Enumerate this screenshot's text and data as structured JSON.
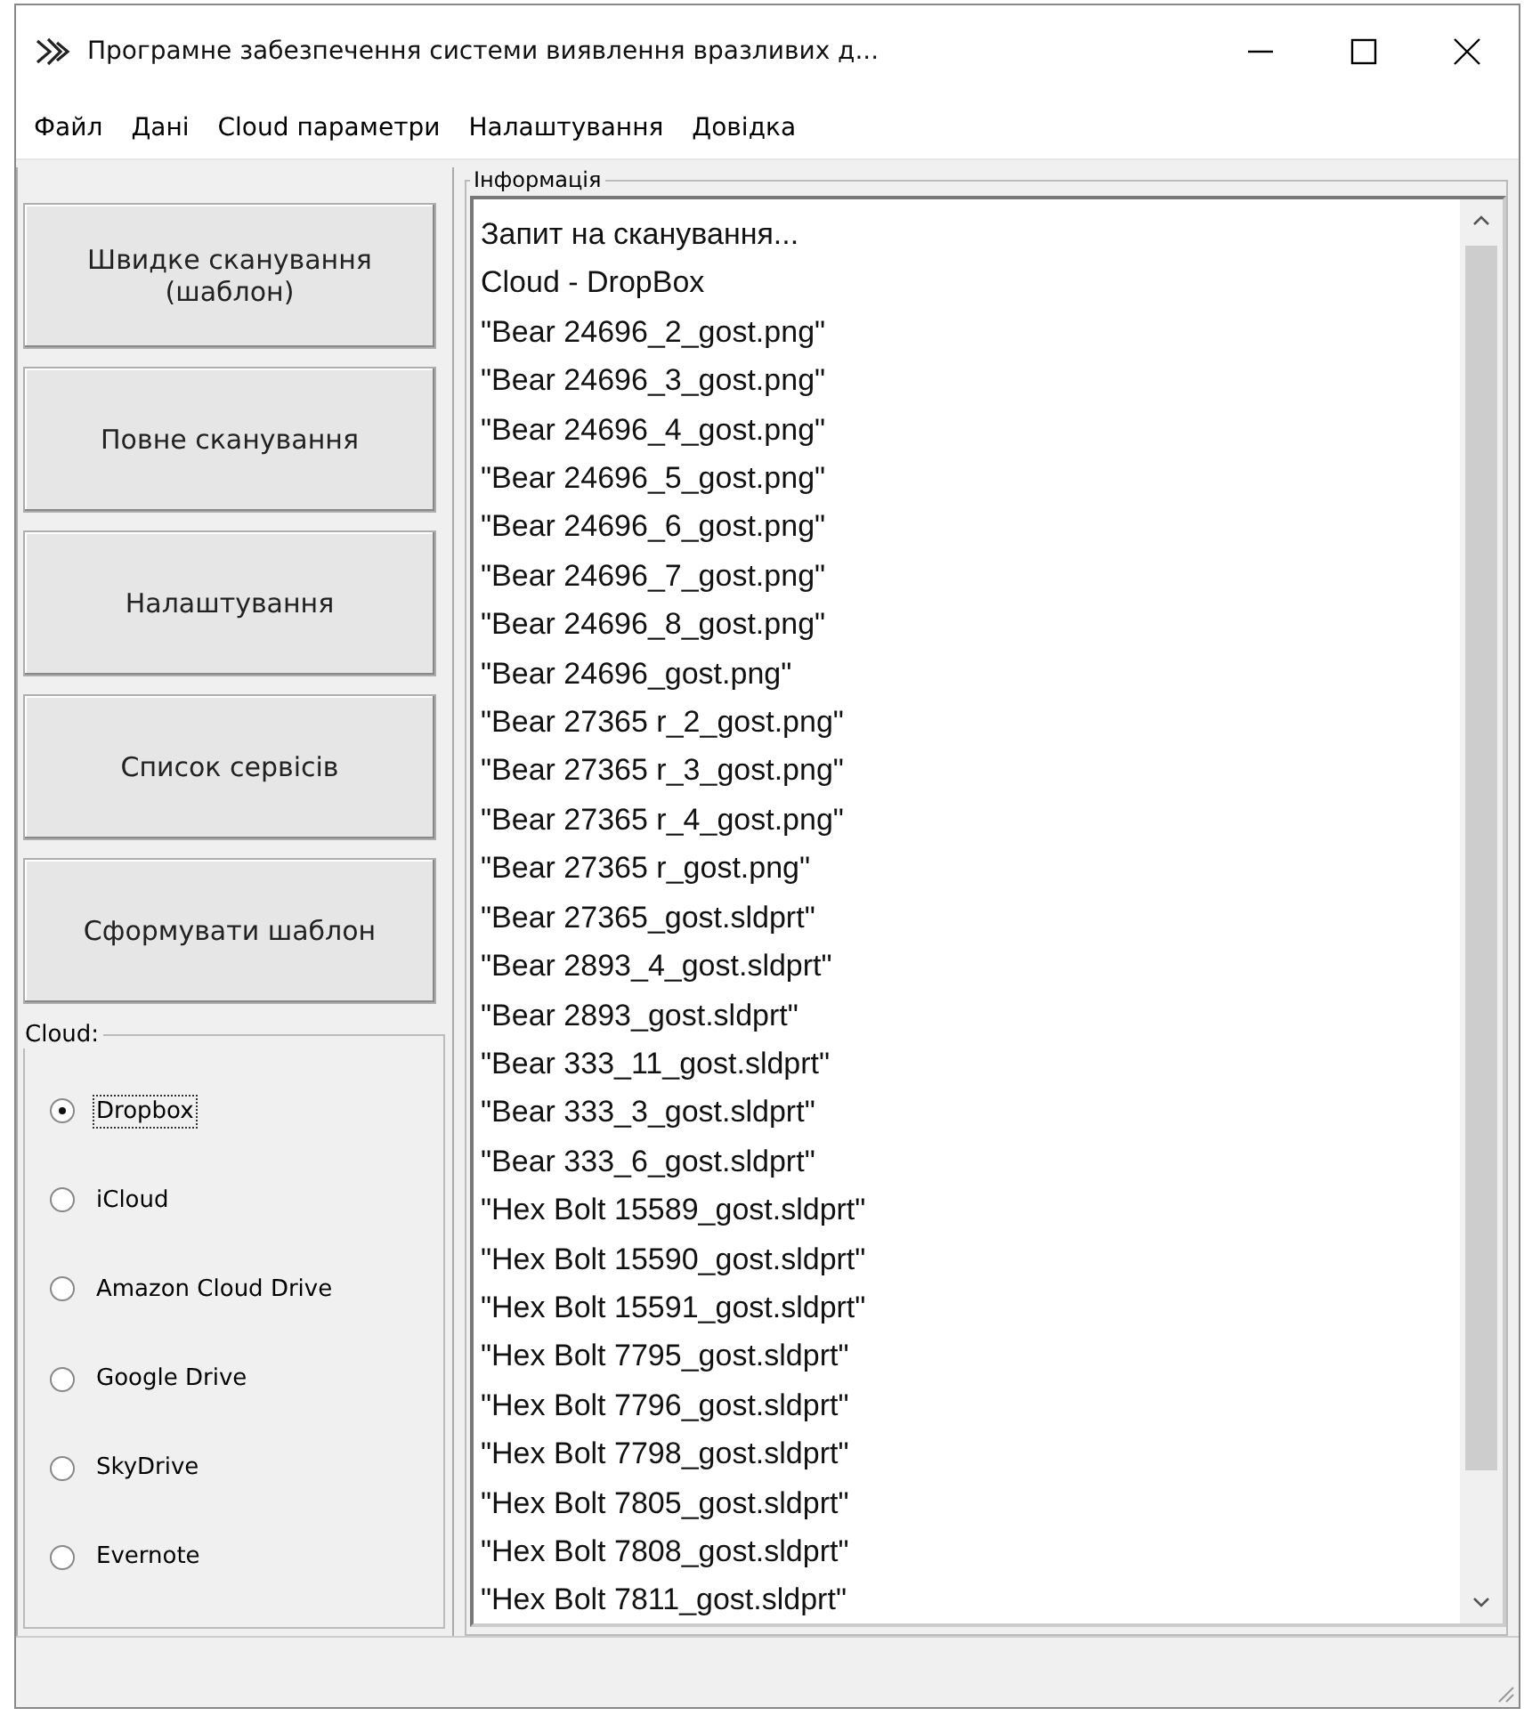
{
  "window": {
    "title": "Програмне забезпечення системи виявлення вразливих д..."
  },
  "menu": [
    "Файл",
    "Дані",
    "Cloud параметри",
    "Налаштування",
    "Довідка"
  ],
  "buttons": [
    "Швидке сканування (шаблон)",
    "Повне сканування",
    "Налаштування",
    "Список сервісів",
    "Сформувати шаблон"
  ],
  "cloud": {
    "label": "Cloud:",
    "options": [
      {
        "label": "Dropbox",
        "selected": true
      },
      {
        "label": "iCloud",
        "selected": false
      },
      {
        "label": "Amazon Cloud Drive",
        "selected": false
      },
      {
        "label": "Google Drive",
        "selected": false
      },
      {
        "label": "SkyDrive",
        "selected": false
      },
      {
        "label": "Evernote",
        "selected": false
      }
    ]
  },
  "info": {
    "label": "Інформація",
    "lines": [
      "Запит на сканування...",
      "Cloud - DropBox",
      "\"Bear 24696_2_gost.png\"",
      "\"Bear 24696_3_gost.png\"",
      "\"Bear 24696_4_gost.png\"",
      "\"Bear 24696_5_gost.png\"",
      "\"Bear 24696_6_gost.png\"",
      "\"Bear 24696_7_gost.png\"",
      "\"Bear 24696_8_gost.png\"",
      "\"Bear 24696_gost.png\"",
      "\"Bear 27365 r_2_gost.png\"",
      "\"Bear 27365 r_3_gost.png\"",
      "\"Bear 27365 r_4_gost.png\"",
      "\"Bear 27365 r_gost.png\"",
      "\"Bear 27365_gost.sldprt\"",
      "\"Bear 2893_4_gost.sldprt\"",
      "\"Bear 2893_gost.sldprt\"",
      "\"Bear 333_11_gost.sldprt\"",
      "\"Bear 333_3_gost.sldprt\"",
      "\"Bear 333_6_gost.sldprt\"",
      "\"Hex Bolt 15589_gost.sldprt\"",
      "\"Hex Bolt 15590_gost.sldprt\"",
      "\"Hex Bolt 15591_gost.sldprt\"",
      "\"Hex Bolt 7795_gost.sldprt\"",
      "\"Hex Bolt 7796_gost.sldprt\"",
      "\"Hex Bolt 7798_gost.sldprt\"",
      "\"Hex Bolt 7805_gost.sldprt\"",
      "\"Hex Bolt 7808_gost.sldprt\"",
      "\"Hex Bolt 7811_gost.sldprt\""
    ]
  }
}
